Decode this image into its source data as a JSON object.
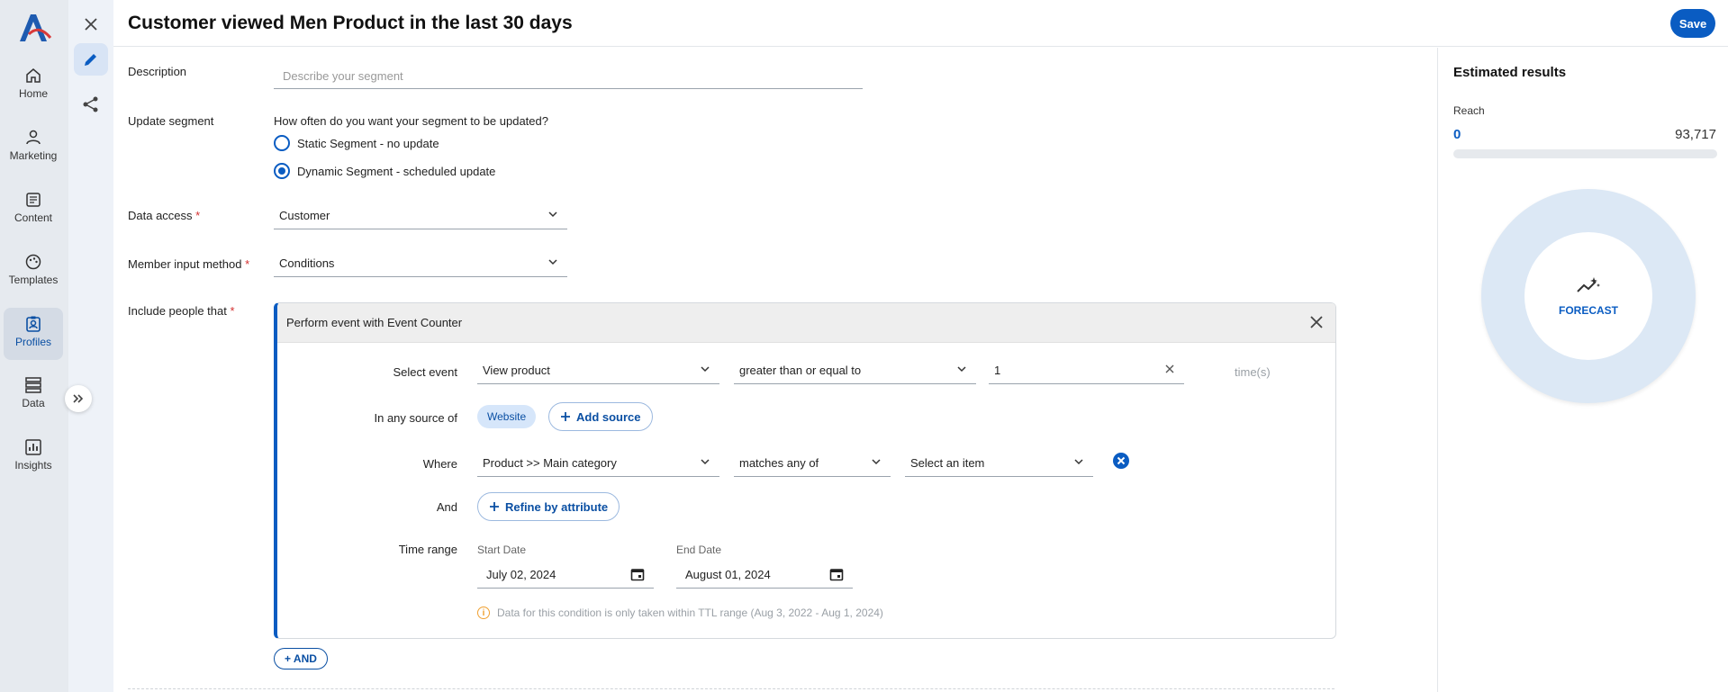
{
  "app": {
    "title": "Customer viewed Men Product in the last 30 days",
    "save_label": "Save"
  },
  "nav": {
    "items": [
      {
        "label": "Home",
        "icon": "home-icon"
      },
      {
        "label": "Marketing",
        "icon": "marketing-icon"
      },
      {
        "label": "Content",
        "icon": "content-icon"
      },
      {
        "label": "Templates",
        "icon": "templates-icon"
      },
      {
        "label": "Profiles",
        "icon": "profiles-icon",
        "active": true
      },
      {
        "label": "Data",
        "icon": "data-icon"
      },
      {
        "label": "Insights",
        "icon": "insights-icon"
      }
    ]
  },
  "form": {
    "description_label": "Description",
    "description_placeholder": "Describe your segment",
    "update_label": "Update segment",
    "update_question": "How often do you want your segment to be updated?",
    "static_option": "Static Segment - no update",
    "dynamic_option": "Dynamic Segment - scheduled update",
    "data_access_label": "Data access",
    "data_access_value": "Customer",
    "member_input_label": "Member input method",
    "member_input_value": "Conditions",
    "include_label": "Include people that",
    "required_mark": "*"
  },
  "condition": {
    "title": "Perform event with Event Counter",
    "select_event_label": "Select event",
    "event_value": "View product",
    "operator_value": "greater than or equal to",
    "count_value": "1",
    "times_label": "time(s)",
    "source_label": "In any source of",
    "source_chip": "Website",
    "add_source_label": "Add source",
    "where_label": "Where",
    "where_attribute": "Product >> Main category",
    "where_operator": "matches any of",
    "where_value_placeholder": "Select an item",
    "and_label": "And",
    "refine_label": "Refine by attribute",
    "time_range_label": "Time range",
    "start_date_label": "Start Date",
    "start_date_value": "July 02, 2024",
    "end_date_label": "End Date",
    "end_date_value": "August 01, 2024",
    "ttl_note": "Data for this condition is only taken within TTL range (Aug 3, 2022 - Aug 1, 2024)"
  },
  "and_button": "AND",
  "results": {
    "title": "Estimated results",
    "reach_label": "Reach",
    "reach_value": "0",
    "reach_total": "93,717",
    "reach_fraction": 0,
    "forecast_label": "FORECAST"
  },
  "colors": {
    "accent": "#0a5cc2",
    "nav_bg": "#e6eaef",
    "required": "#d32f2f"
  }
}
